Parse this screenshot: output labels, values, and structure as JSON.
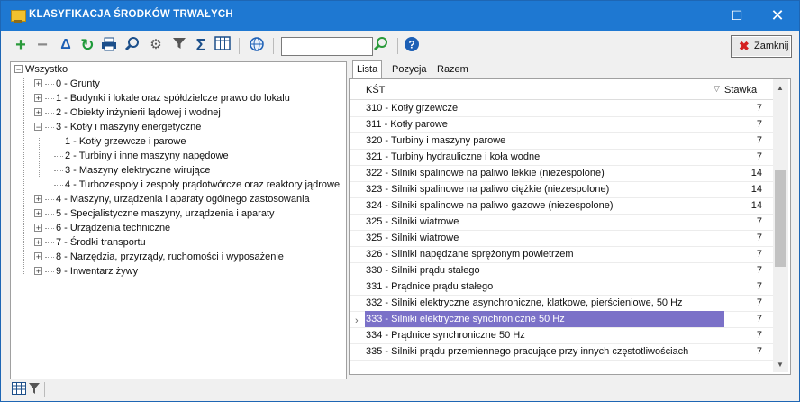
{
  "window": {
    "title": "KLASYFIKACJA ŚRODKÓW TRWAŁYCH",
    "maximize_glyph": "☐",
    "close_glyph": "✕"
  },
  "toolbar": {
    "icons": [
      "plus-icon",
      "minus-icon",
      "delta-icon",
      "refresh-icon",
      "printer-icon",
      "search-icon",
      "gear-icon",
      "filter-icon",
      "sum-icon",
      "columns-icon",
      "globe-icon",
      "find-icon",
      "help-icon"
    ],
    "search_value": "",
    "close_button_label": "Zamknij",
    "colors": {
      "plus": "#2a9a3a",
      "refresh": "#1f9a3a",
      "accent": "#1e78d2",
      "help": "#1c5fb5",
      "close_x": "#d42020"
    }
  },
  "tree": {
    "root": "Wszystko",
    "items": [
      {
        "label": "0 - Grunty",
        "level": 1,
        "expandable": true,
        "expanded": false
      },
      {
        "label": "1 - Budynki i lokale oraz spółdzielcze prawo do lokalu",
        "level": 1,
        "expandable": true,
        "expanded": false
      },
      {
        "label": "2 - Obiekty inżynierii lądowej i wodnej",
        "level": 1,
        "expandable": true,
        "expanded": false
      },
      {
        "label": "3 - Kotły i maszyny energetyczne",
        "level": 1,
        "expandable": true,
        "expanded": true
      },
      {
        "label": "1 - Kotły grzewcze i parowe",
        "level": 2,
        "expandable": false
      },
      {
        "label": "2 - Turbiny i inne maszyny napędowe",
        "level": 2,
        "expandable": false
      },
      {
        "label": "3 - Maszyny elektryczne wirujące",
        "level": 2,
        "expandable": false
      },
      {
        "label": "4 - Turbozespoły i zespoły prądotwórcze oraz reaktory jądrowe",
        "level": 2,
        "expandable": false
      },
      {
        "label": "4 - Maszyny, urządzenia i aparaty ogólnego zastosowania",
        "level": 1,
        "expandable": true,
        "expanded": false
      },
      {
        "label": "5 - Specjalistyczne maszyny, urządzenia i aparaty",
        "level": 1,
        "expandable": true,
        "expanded": false
      },
      {
        "label": "6 - Urządzenia techniczne",
        "level": 1,
        "expandable": true,
        "expanded": false
      },
      {
        "label": "7 - Środki transportu",
        "level": 1,
        "expandable": true,
        "expanded": false
      },
      {
        "label": "8 - Narzędzia, przyrządy, ruchomości i wyposażenie",
        "level": 1,
        "expandable": true,
        "expanded": false
      },
      {
        "label": "9 - Inwentarz żywy",
        "level": 1,
        "expandable": true,
        "expanded": false
      }
    ]
  },
  "tabs": [
    {
      "label": "Lista",
      "active": true
    },
    {
      "label": "Pozycja",
      "active": false
    },
    {
      "label": "Razem",
      "active": false
    }
  ],
  "grid": {
    "columns": {
      "kst": "KŚT",
      "stawka": "Stawka"
    },
    "selected_index": 13,
    "rows": [
      {
        "name": "310 - Kotły grzewcze",
        "rate": "7"
      },
      {
        "name": "311 - Kotły parowe",
        "rate": "7"
      },
      {
        "name": "320 - Turbiny i maszyny parowe",
        "rate": "7"
      },
      {
        "name": "321 - Turbiny hydrauliczne i koła wodne",
        "rate": "7"
      },
      {
        "name": "322 - Silniki spalinowe na paliwo lekkie (niezespolone)",
        "rate": "14"
      },
      {
        "name": "323 - Silniki spalinowe na paliwo ciężkie (niezespolone)",
        "rate": "14"
      },
      {
        "name": "324 - Silniki spalinowe na paliwo gazowe (niezespolone)",
        "rate": "14"
      },
      {
        "name": "325 - Silniki wiatrowe",
        "rate": "7"
      },
      {
        "name": "325 - Silniki wiatrowe",
        "rate": "7"
      },
      {
        "name": "326 - Silniki napędzane sprężonym powietrzem",
        "rate": "7"
      },
      {
        "name": "330 - Silniki prądu stałego",
        "rate": "7"
      },
      {
        "name": "331 - Prądnice prądu stałego",
        "rate": "7"
      },
      {
        "name": "332 - Silniki elektryczne asynchroniczne, klatkowe, pierścieniowe, 50 Hz",
        "rate": "7"
      },
      {
        "name": "333 - Silniki elektryczne synchroniczne 50 Hz",
        "rate": "7"
      },
      {
        "name": "334 - Prądnice synchroniczne 50 Hz",
        "rate": "7"
      },
      {
        "name": "335 - Silniki prądu przemiennego pracujące przy innych częstotliwościach",
        "rate": "7"
      }
    ]
  }
}
